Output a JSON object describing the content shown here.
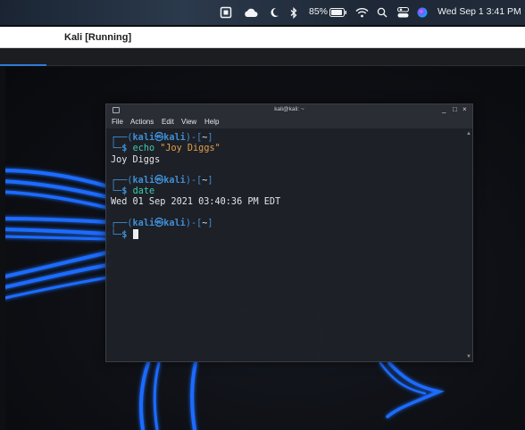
{
  "menubar": {
    "icons": [
      "stop-app-icon",
      "cloud-icon",
      "moon-icon",
      "bluetooth-icon",
      "battery-icon",
      "wifi-icon",
      "search-icon",
      "control-center-icon",
      "siri-icon"
    ],
    "battery_percent": "85%",
    "clock": "Wed Sep 1  3:41 PM"
  },
  "vbox": {
    "title": "Kali [Running]"
  },
  "terminal": {
    "title": "kali@kali: ~",
    "menu": [
      "File",
      "Actions",
      "Edit",
      "View",
      "Help"
    ],
    "controls": [
      "_",
      "□",
      "×"
    ],
    "prompt": {
      "open": "┌──(",
      "user": "kali",
      "at": "㉿",
      "host": "kali",
      "mid": ")-[",
      "dir": "~",
      "close": "]",
      "arrow": "└─",
      "dollar": "$"
    },
    "commands": [
      {
        "cmd": "echo",
        "arg": "\"Joy Diggs\"",
        "output": "Joy Diggs"
      },
      {
        "cmd": "date",
        "arg": "",
        "output": "Wed 01 Sep 2021 03:40:36 PM EDT"
      }
    ]
  },
  "colors": {
    "prompt_blue": "#3f8fd6",
    "command_teal": "#3ecbb0",
    "string_orange": "#e0a24c",
    "dragon_glow": "#1f6cff"
  }
}
